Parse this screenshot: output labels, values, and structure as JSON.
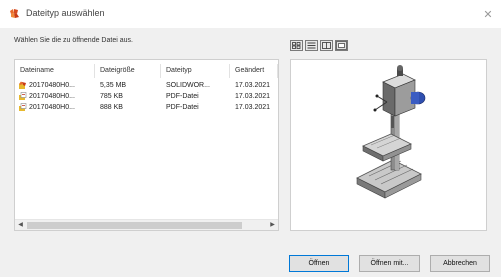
{
  "window": {
    "title": "Dateityp auswählen",
    "close_label": "✕"
  },
  "prompt": "Wählen Sie die zu öffnende Datei aus.",
  "list": {
    "columns": [
      "Dateiname",
      "Dateigröße",
      "Dateityp",
      "Geändert"
    ],
    "rows": [
      {
        "name": "20170480H0...",
        "size": "5,35 MB",
        "type": "SOLIDWOR...",
        "modified": "17.03.2021",
        "icon": "solidworks-file-icon"
      },
      {
        "name": "20170480H0...",
        "size": "785 KB",
        "type": "PDF-Datei",
        "modified": "17.03.2021",
        "icon": "pdf-file-icon"
      },
      {
        "name": "20170480H0...",
        "size": "888 KB",
        "type": "PDF-Datei",
        "modified": "17.03.2021",
        "icon": "pdf-file-icon"
      }
    ],
    "scroll_left": "◀",
    "scroll_right": "▶"
  },
  "view_buttons": [
    "large-icons-view-icon",
    "details-view-icon",
    "list-view-icon",
    "preview-view-icon"
  ],
  "buttons": {
    "open": "Öffnen",
    "open_with": "Öffnen mit...",
    "cancel": "Abbrechen"
  },
  "colors": {
    "accent": "#0078d7",
    "icon_orange": "#e8692a",
    "icon_yellow": "#e7b92e"
  }
}
